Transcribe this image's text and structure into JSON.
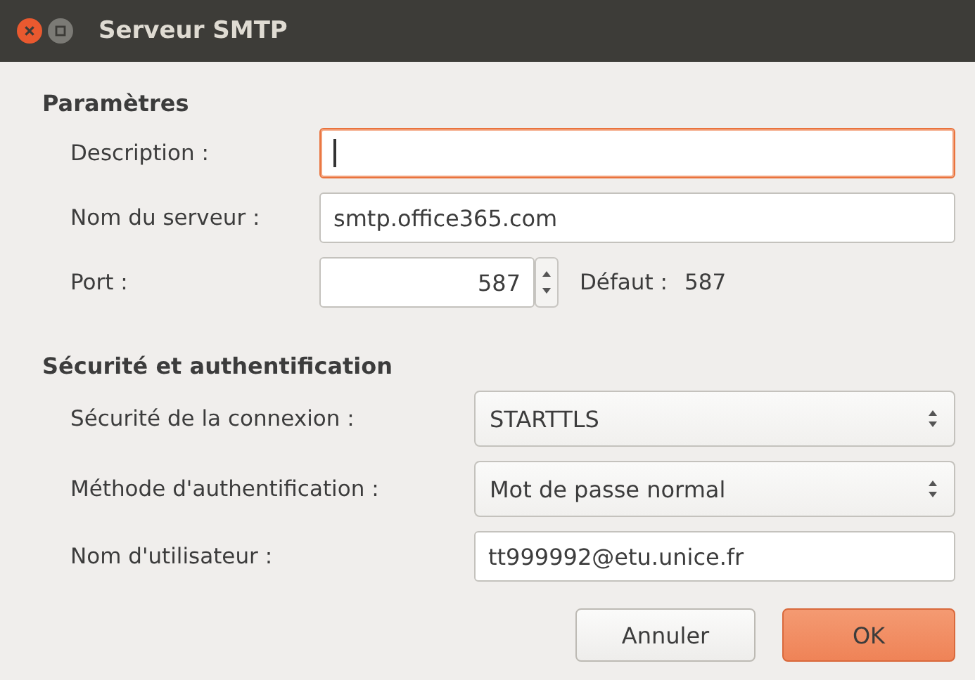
{
  "window": {
    "title": "Serveur SMTP"
  },
  "sections": [
    {
      "title": "Paramètres",
      "rows": [
        {
          "label": "Description :",
          "kind": "text",
          "focused": true
        },
        {
          "label": "Nom du serveur :",
          "kind": "text",
          "value": "smtp.office365.com",
          "focused": false
        },
        {
          "label": "Port :",
          "kind": "spin",
          "value": "587",
          "focused": false,
          "default_label": "Défaut :",
          "default_value": "587"
        }
      ]
    },
    {
      "title": "Sécurité et authentification",
      "rows": [
        {
          "label": "Sécurité de la connexion :",
          "kind": "select",
          "value": "STARTTLS",
          "focused": false
        },
        {
          "label": "Méthode d'authentification :",
          "kind": "select",
          "value": "Mot de passe normal",
          "focused": false
        },
        {
          "label": "Nom d'utilisateur :",
          "kind": "text",
          "value": "tt999992@etu.unice.fr",
          "focused": false
        }
      ]
    }
  ],
  "buttons": [
    {
      "label": "Annuler",
      "default": false
    },
    {
      "label": "OK",
      "default": true
    }
  ]
}
